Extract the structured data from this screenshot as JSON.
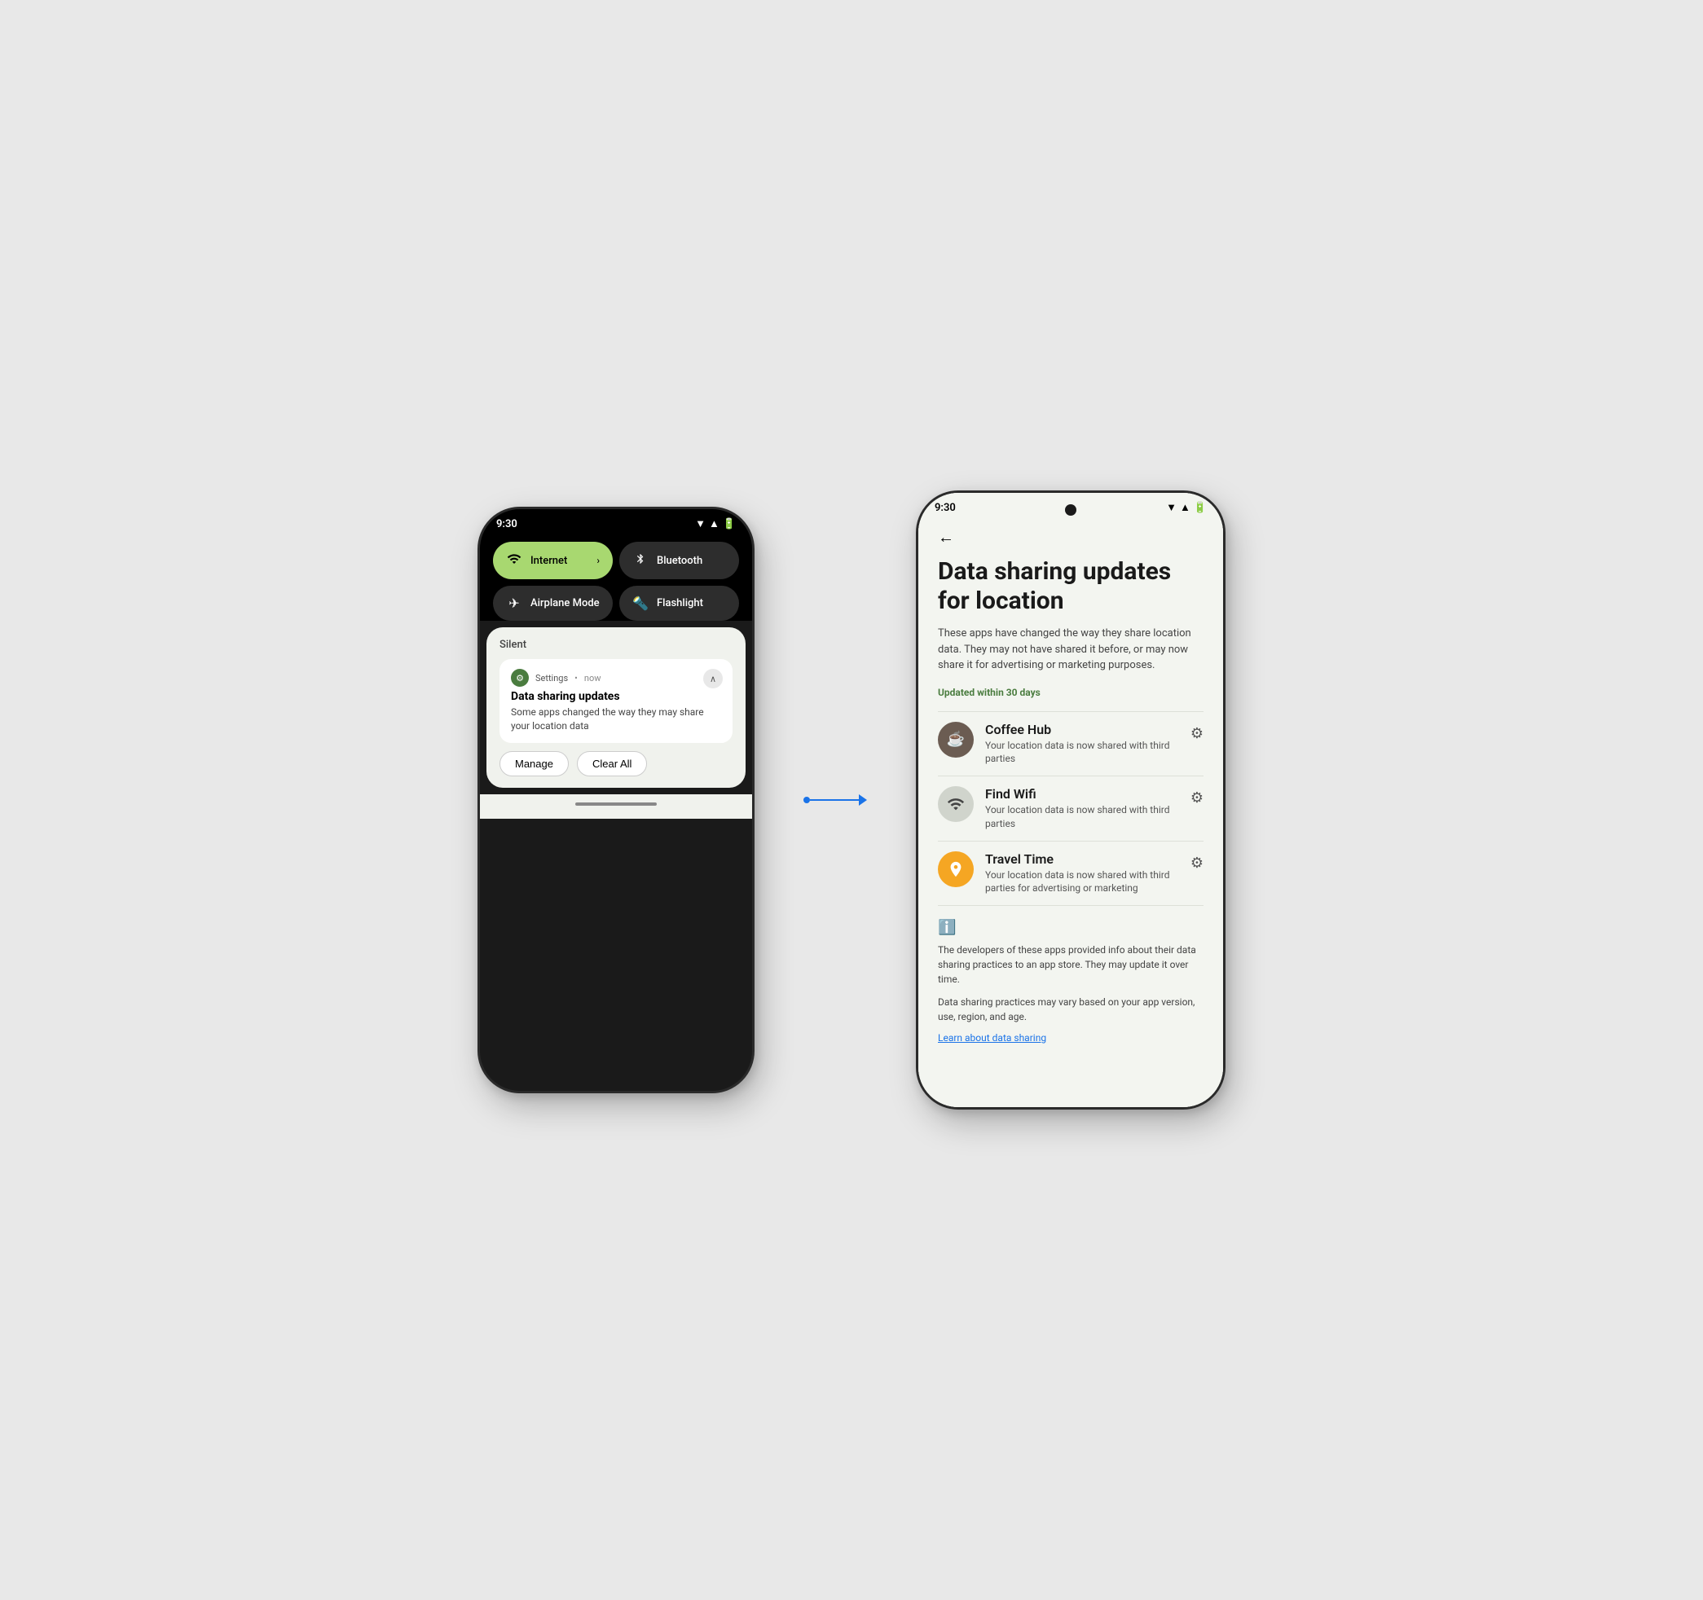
{
  "left_phone": {
    "status_time": "9:30",
    "quick_tiles": [
      {
        "id": "internet",
        "label": "Internet",
        "active": true,
        "icon": "wifi",
        "has_chevron": true
      },
      {
        "id": "bluetooth",
        "label": "Bluetooth",
        "active": false,
        "icon": "bt"
      },
      {
        "id": "airplane",
        "label": "Airplane Mode",
        "active": false,
        "icon": "plane"
      },
      {
        "id": "flashlight",
        "label": "Flashlight",
        "active": false,
        "icon": "flash"
      }
    ],
    "notification": {
      "section_label": "Silent",
      "app_name": "Settings",
      "time": "now",
      "title": "Data sharing updates",
      "body": "Some apps changed the way they may share your location data",
      "action_manage": "Manage",
      "action_clear": "Clear All"
    }
  },
  "right_phone": {
    "status_time": "9:30",
    "back_label": "←",
    "page_title": "Data sharing updates for location",
    "page_subtitle": "These apps have changed the way they share location data. They may not have shared it before, or may now share it for advertising or marketing purposes.",
    "updated_label": "Updated within 30 days",
    "apps": [
      {
        "name": "Coffee Hub",
        "desc": "Your location data is now shared with third parties",
        "icon_type": "coffee",
        "icon_symbol": "☕"
      },
      {
        "name": "Find Wifi",
        "desc": "Your location data is now shared with third parties",
        "icon_type": "wifi",
        "icon_symbol": "wifi"
      },
      {
        "name": "Travel Time",
        "desc": "Your location data is now shared with third parties for advertising or marketing",
        "icon_type": "travel",
        "icon_symbol": "nav"
      }
    ],
    "info_text_1": "The developers of these apps provided info about their data sharing practices to an app store. They may update it over time.",
    "info_text_2": "Data sharing practices may vary based on your app version, use, region, and age.",
    "learn_link": "Learn about data sharing"
  },
  "arrow": {
    "color": "#1a73e8"
  }
}
